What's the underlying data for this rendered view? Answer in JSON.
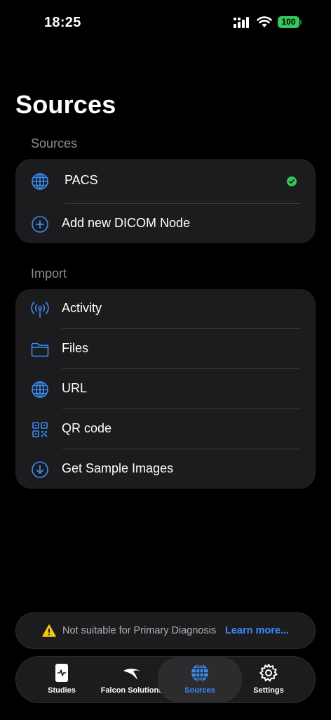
{
  "status_bar": {
    "time": "18:25",
    "battery": "100"
  },
  "page_title": "Sources",
  "sources_section": {
    "header": "Sources",
    "items": [
      {
        "label": "PACS",
        "icon": "globe-icon",
        "status": "connected"
      },
      {
        "label": "Add new DICOM Node",
        "icon": "plus-circle-icon"
      }
    ]
  },
  "import_section": {
    "header": "Import",
    "items": [
      {
        "label": "Activity",
        "icon": "antenna-icon"
      },
      {
        "label": "Files",
        "icon": "folder-icon"
      },
      {
        "label": "URL",
        "icon": "globe-icon"
      },
      {
        "label": "QR code",
        "icon": "qr-code-icon"
      },
      {
        "label": "Get Sample Images",
        "icon": "download-circle-icon"
      }
    ]
  },
  "warning": {
    "text": "Not suitable for Primary Diagnosis",
    "link": "Learn more..."
  },
  "tabs": [
    {
      "label": "Studies",
      "icon": "studies-icon"
    },
    {
      "label": "Falcon Solutions",
      "icon": "falcon-icon"
    },
    {
      "label": "Sources",
      "icon": "globe-icon",
      "active": true
    },
    {
      "label": "Settings",
      "icon": "gear-icon"
    }
  ],
  "colors": {
    "accent": "#3a8ef6",
    "status_ok": "#34c759",
    "warning": "#f5c518",
    "card": "#1c1c1e",
    "background": "#000000"
  }
}
